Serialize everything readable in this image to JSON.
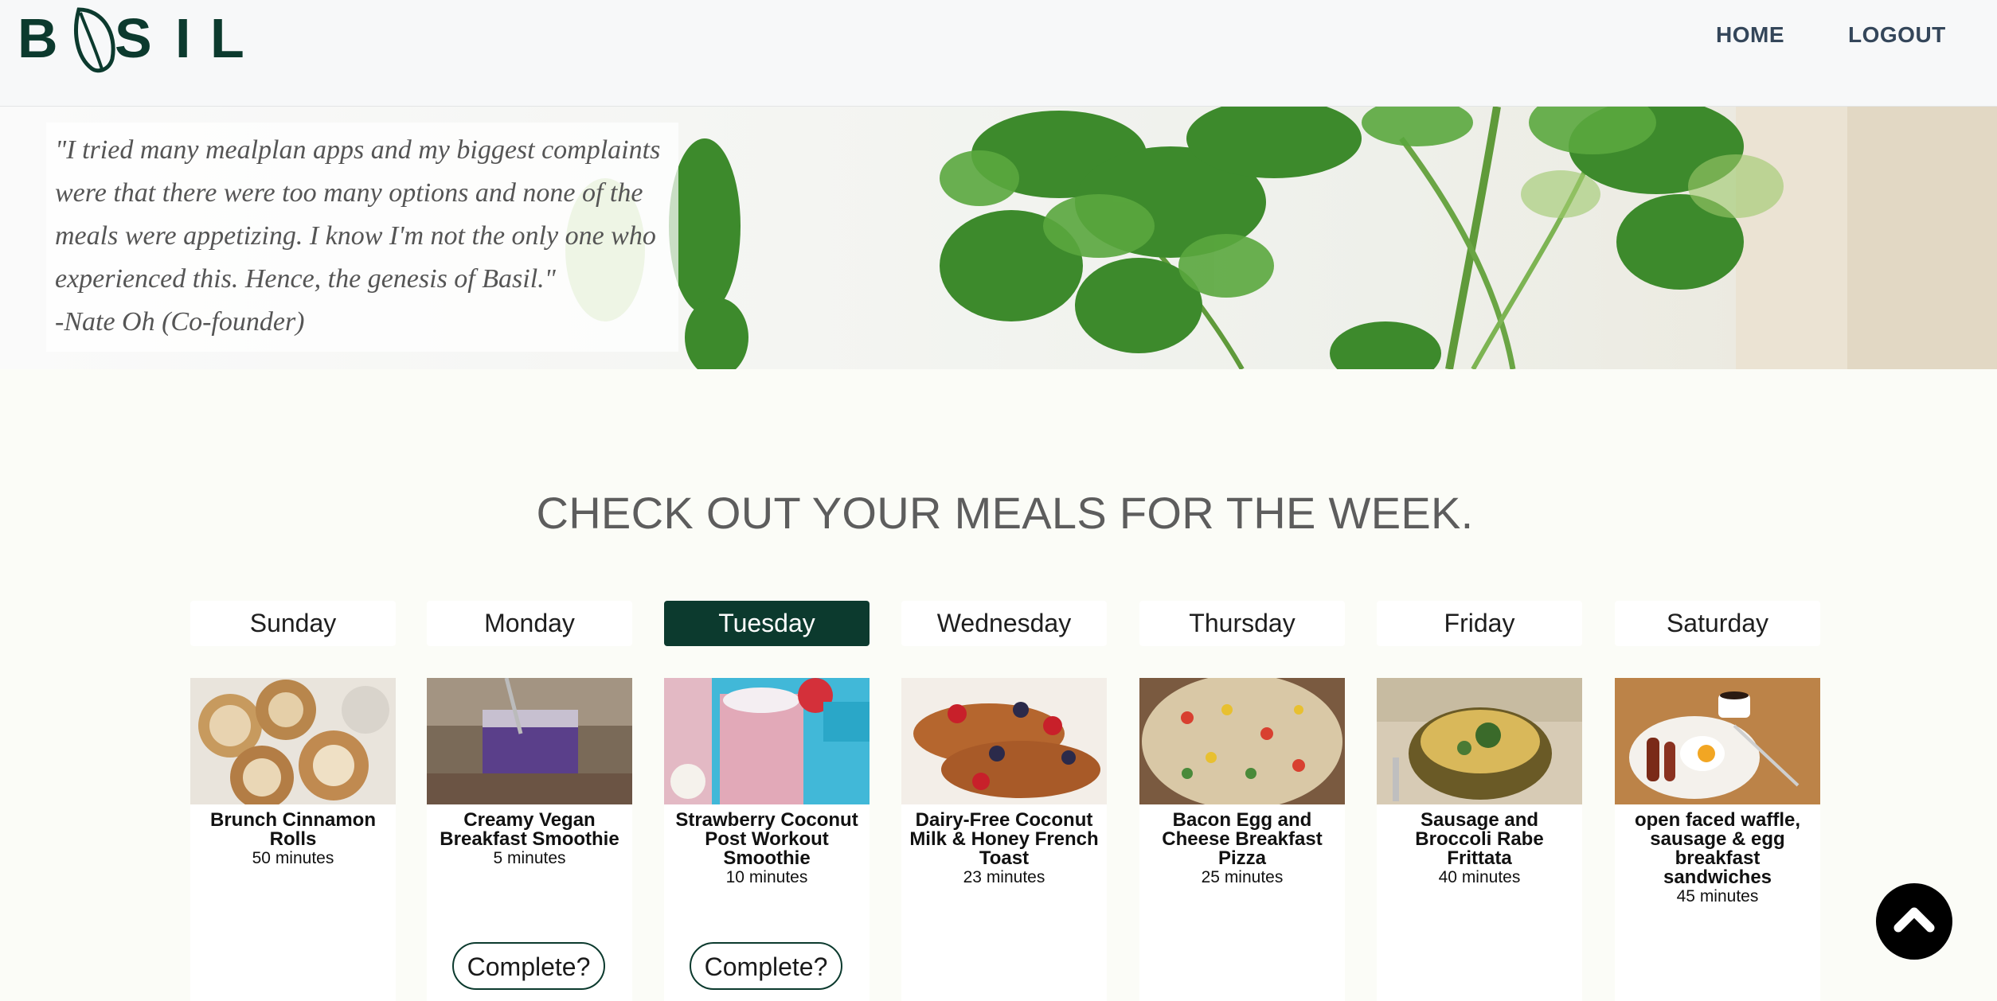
{
  "header": {
    "logo_text": "BASIL",
    "nav": {
      "home": "HOME",
      "logout": "LOGOUT"
    }
  },
  "hero": {
    "quote": "\"I tried many mealplan apps and my biggest complaints were that there were too many options and none of the meals were appetizing. I know I'm not the only one who experienced this. Hence, the genesis of Basil.\"",
    "author": "-Nate Oh (Co-founder)"
  },
  "section_title": "CHECK OUT YOUR MEALS FOR THE WEEK.",
  "days": [
    {
      "label": "Sunday",
      "active": false
    },
    {
      "label": "Monday",
      "active": false
    },
    {
      "label": "Tuesday",
      "active": true
    },
    {
      "label": "Wednesday",
      "active": false
    },
    {
      "label": "Thursday",
      "active": false
    },
    {
      "label": "Friday",
      "active": false
    },
    {
      "label": "Saturday",
      "active": false
    }
  ],
  "meals": [
    {
      "title": "Brunch Cinnamon Rolls",
      "time": "50 minutes",
      "image": "cinnamon-rolls"
    },
    {
      "title": "Creamy Vegan Breakfast Smoothie",
      "time": "5 minutes",
      "image": "purple-smoothie",
      "button": "Complete?"
    },
    {
      "title": "Strawberry Coconut Post Workout Smoothie",
      "time": "10 minutes",
      "image": "pink-smoothie",
      "button": "Complete?"
    },
    {
      "title": "Dairy-Free Coconut Milk & Honey French Toast",
      "time": "23 minutes",
      "image": "french-toast"
    },
    {
      "title": "Bacon Egg and Cheese Breakfast Pizza",
      "time": "25 minutes",
      "image": "breakfast-pizza"
    },
    {
      "title": "Sausage and Broccoli Rabe Frittata",
      "time": "40 minutes",
      "image": "frittata"
    },
    {
      "title": "open faced waffle, sausage & egg breakfast sandwiches",
      "time": "45 minutes",
      "image": "waffle-sandwich"
    }
  ],
  "colors": {
    "brand": "#0c3a2e",
    "nav": "#34465a",
    "page_bg": "#fbfcf7",
    "title": "#5d5d5d"
  },
  "icons": {
    "scroll_top": "chevron-up-icon",
    "logo_leaf": "leaf-icon"
  }
}
